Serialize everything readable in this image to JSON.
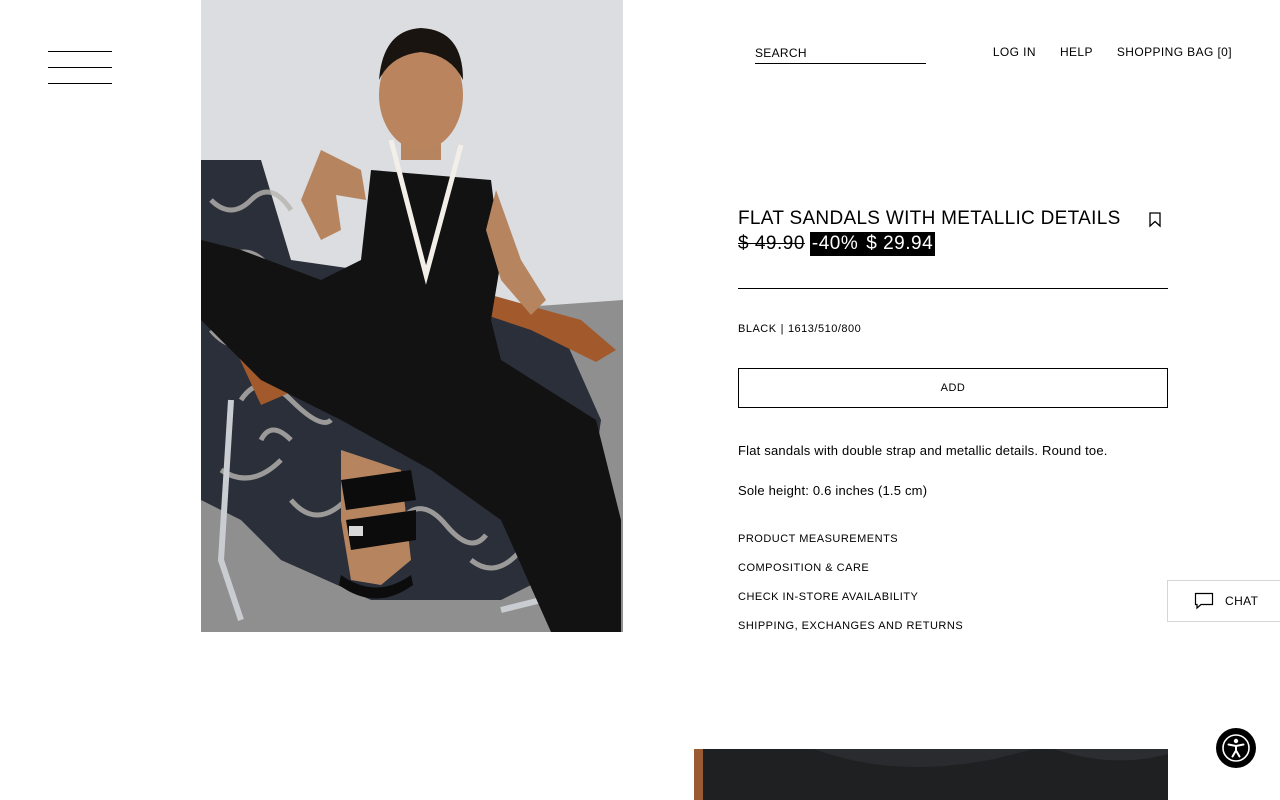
{
  "header": {
    "search_placeholder": "SEARCH",
    "nav": {
      "login": "LOG IN",
      "help": "HELP",
      "bag": "SHOPPING BAG [0]"
    }
  },
  "product": {
    "title": "FLAT SANDALS WITH METALLIC DETAILS",
    "price_original": "$ 49.90",
    "discount": "-40%",
    "price_sale": "$ 29.94",
    "color": "BLACK",
    "separator": "|",
    "reference": "1613/510/800",
    "add_label": "ADD",
    "description": "Flat sandals with double strap and metallic details. Round toe.",
    "sole_height": "Sole height: 0.6 inches (1.5 cm)",
    "links": [
      "PRODUCT MEASUREMENTS",
      "COMPOSITION & CARE",
      "CHECK IN-STORE AVAILABILITY",
      "SHIPPING, EXCHANGES AND RETURNS"
    ]
  },
  "chat": {
    "label": "CHAT"
  },
  "icons": {
    "menu": "hamburger-menu-icon",
    "bookmark": "bookmark-icon",
    "chat": "chat-bubble-icon",
    "accessibility": "accessibility-icon"
  },
  "colors": {
    "text": "#000000",
    "background": "#ffffff",
    "sale_badge_bg": "#000000",
    "sale_badge_text": "#ffffff"
  }
}
